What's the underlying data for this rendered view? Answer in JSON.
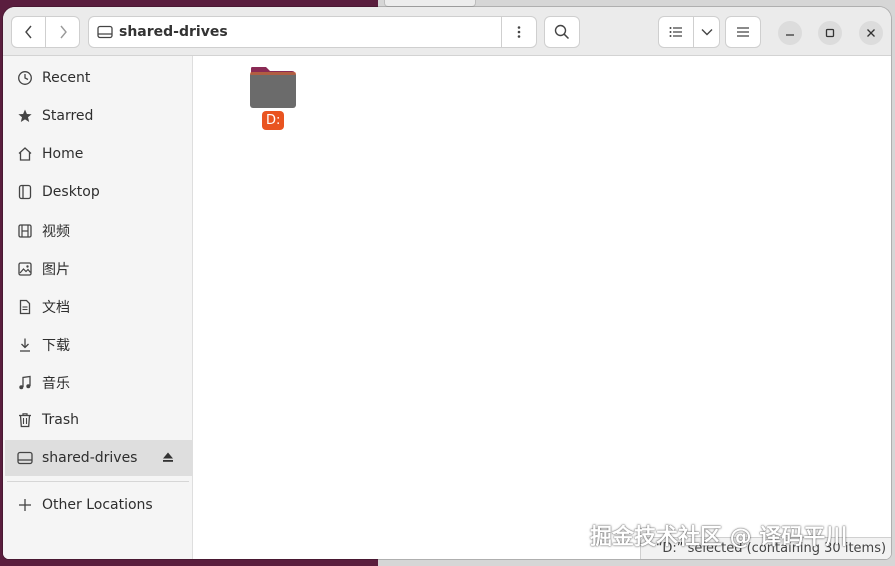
{
  "window": {
    "path_label": "shared-drives"
  },
  "sidebar": {
    "items": [
      {
        "label": "Recent",
        "icon": "clock-icon"
      },
      {
        "label": "Starred",
        "icon": "star-icon"
      },
      {
        "label": "Home",
        "icon": "home-icon"
      },
      {
        "label": "Desktop",
        "icon": "desktop-icon"
      },
      {
        "label": "视频",
        "icon": "video-icon"
      },
      {
        "label": "图片",
        "icon": "picture-icon"
      },
      {
        "label": "文档",
        "icon": "document-icon"
      },
      {
        "label": "下载",
        "icon": "download-icon"
      },
      {
        "label": "音乐",
        "icon": "music-icon"
      },
      {
        "label": "Trash",
        "icon": "trash-icon"
      },
      {
        "label": "shared-drives",
        "icon": "drive-icon",
        "active": true
      },
      {
        "label": "Other Locations",
        "icon": "plus-icon"
      }
    ]
  },
  "content": {
    "files": [
      {
        "name": "D:",
        "icon": "folder-icon",
        "selected": true
      }
    ]
  },
  "status_bar": {
    "text": "“D:” selected  (containing 30 items)"
  },
  "watermark": {
    "text": "掘金技术社区 @ 译码平川"
  },
  "colors": {
    "accent": "#e95420",
    "folder_body": "#6b6b6b",
    "folder_tab": "#8a2a55",
    "desktop_bg": "#5a1e3e"
  }
}
